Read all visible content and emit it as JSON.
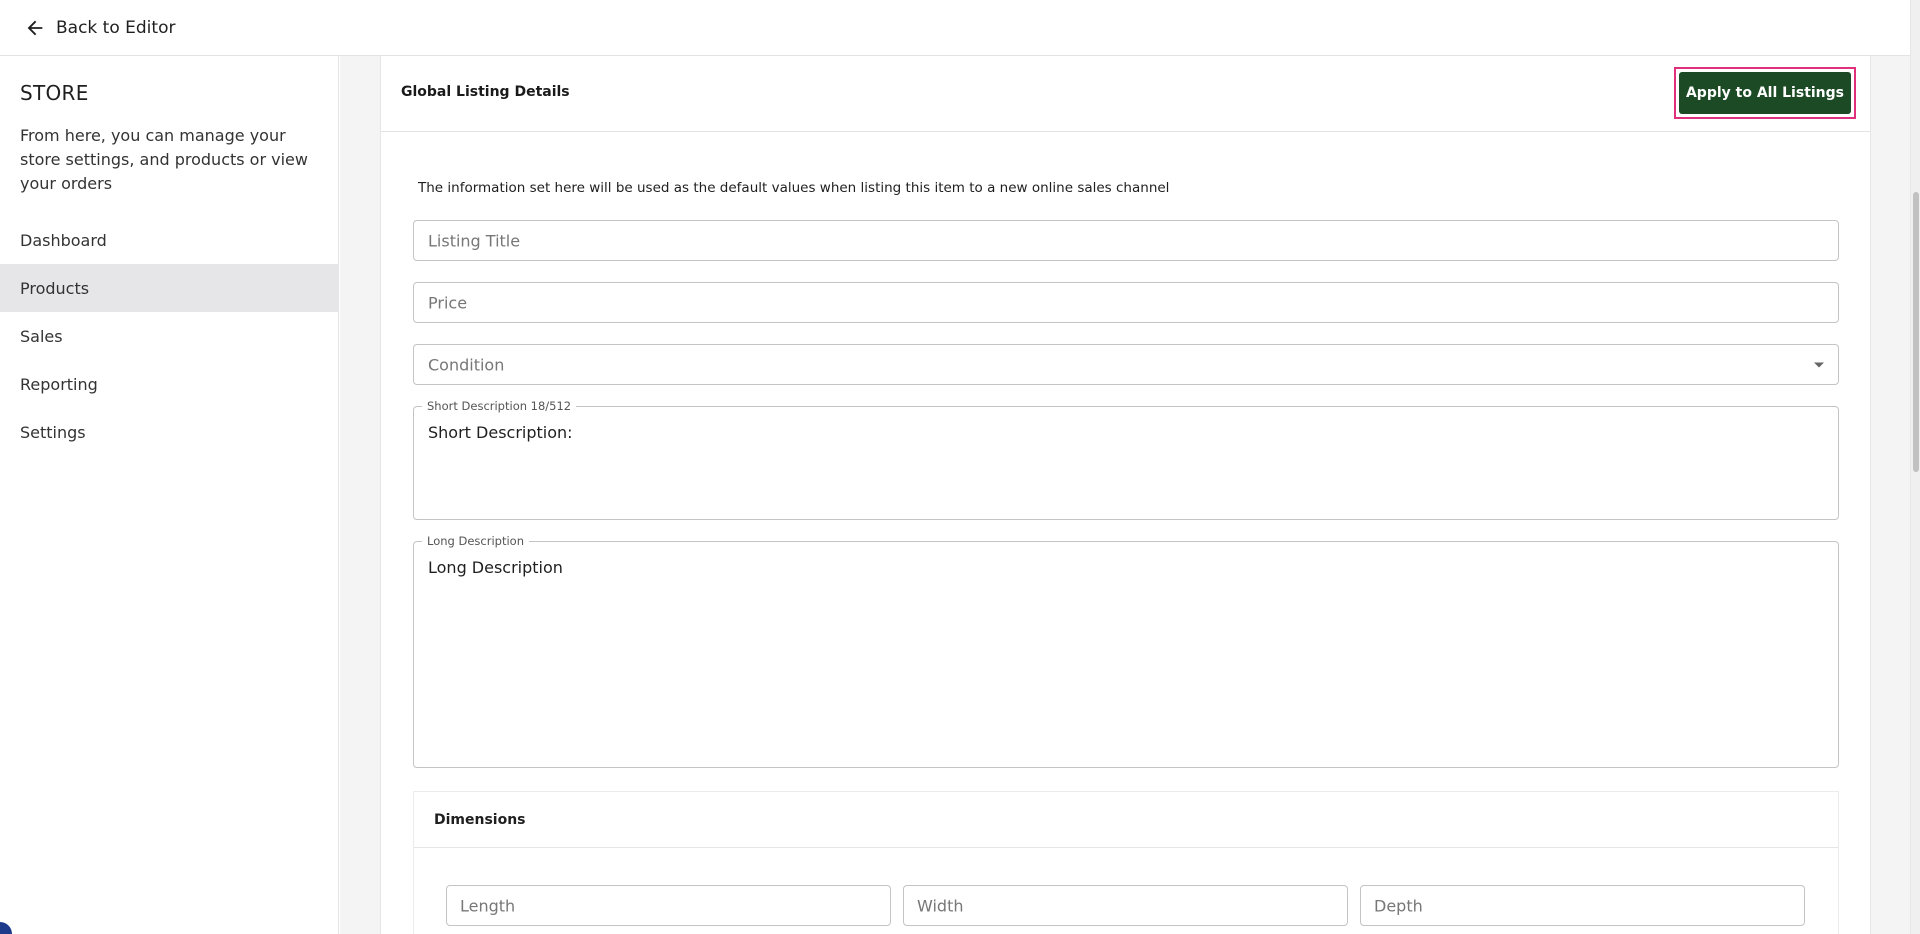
{
  "topbar": {
    "back_label": "Back to Editor",
    "back_icon": "arrow-left-icon"
  },
  "sidebar": {
    "title": "STORE",
    "description": "From here, you can manage your store settings, and products or view your orders",
    "items": [
      {
        "label": "Dashboard",
        "active": false
      },
      {
        "label": "Products",
        "active": true
      },
      {
        "label": "Sales",
        "active": false
      },
      {
        "label": "Reporting",
        "active": false
      },
      {
        "label": "Settings",
        "active": false
      }
    ]
  },
  "main": {
    "card_title": "Global Listing Details",
    "apply_button_label": "Apply to All Listings",
    "info_text": "The information set here will be used as the default values when listing this item to a new online sales channel",
    "fields": {
      "listing_title_placeholder": "Listing Title",
      "price_placeholder": "Price",
      "condition_placeholder": "Condition",
      "short_description_label": "Short Description 18/512",
      "short_description_value": "Short Description:",
      "long_description_label": "Long Description",
      "long_description_value": "Long Description"
    },
    "dimensions": {
      "title": "Dimensions",
      "length_placeholder": "Length",
      "width_placeholder": "Width",
      "depth_placeholder": "Depth"
    }
  },
  "colors": {
    "accent_button": "#1c4a25",
    "highlight_border": "#e0307c",
    "active_nav_bg": "#e6e6e9"
  }
}
